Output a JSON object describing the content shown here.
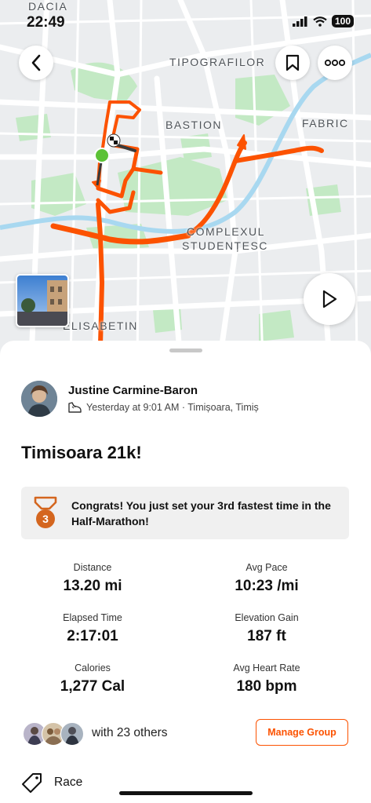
{
  "status_bar": {
    "time": "22:49",
    "battery": "100"
  },
  "map": {
    "labels": {
      "dacia": "DACIA",
      "tipografilor": "TIPOGRAFILOR",
      "bastion": "BASTION",
      "fabric": "FABRIC",
      "complexul_1": "COMPLEXUL",
      "complexul_2": "STUDENȚESC",
      "elisabetin": "ELISABETIN"
    },
    "route_color": "#fc5200",
    "water_color": "#a8d8f0",
    "park_color": "#bfe8c0"
  },
  "icons": {
    "back": "chevron-left-icon",
    "bookmark": "bookmark-icon",
    "more": "more-options-icon",
    "play": "play-icon",
    "shoe": "shoe-icon",
    "medal": "medal-icon",
    "tag": "tag-icon"
  },
  "activity": {
    "athlete": "Justine  Carmine-Baron",
    "meta": "Yesterday at 9:01 AM · Timișoara, Timiș",
    "title": "Timisoara 21k!",
    "achievement": {
      "rank": "3",
      "text": "Congrats! You just set your 3rd fastest time in the Half-Marathon!"
    },
    "stats": [
      {
        "label": "Distance",
        "value": "13.20 mi"
      },
      {
        "label": "Avg Pace",
        "value": "10:23 /mi"
      },
      {
        "label": "Elapsed Time",
        "value": "2:17:01"
      },
      {
        "label": "Elevation Gain",
        "value": "187 ft"
      },
      {
        "label": "Calories",
        "value": "1,277 Cal"
      },
      {
        "label": "Avg Heart Rate",
        "value": "180 bpm"
      }
    ],
    "group_text": "with 23 others",
    "manage_group": "Manage Group",
    "tag": "Race"
  },
  "accent_color": "#fc5200"
}
